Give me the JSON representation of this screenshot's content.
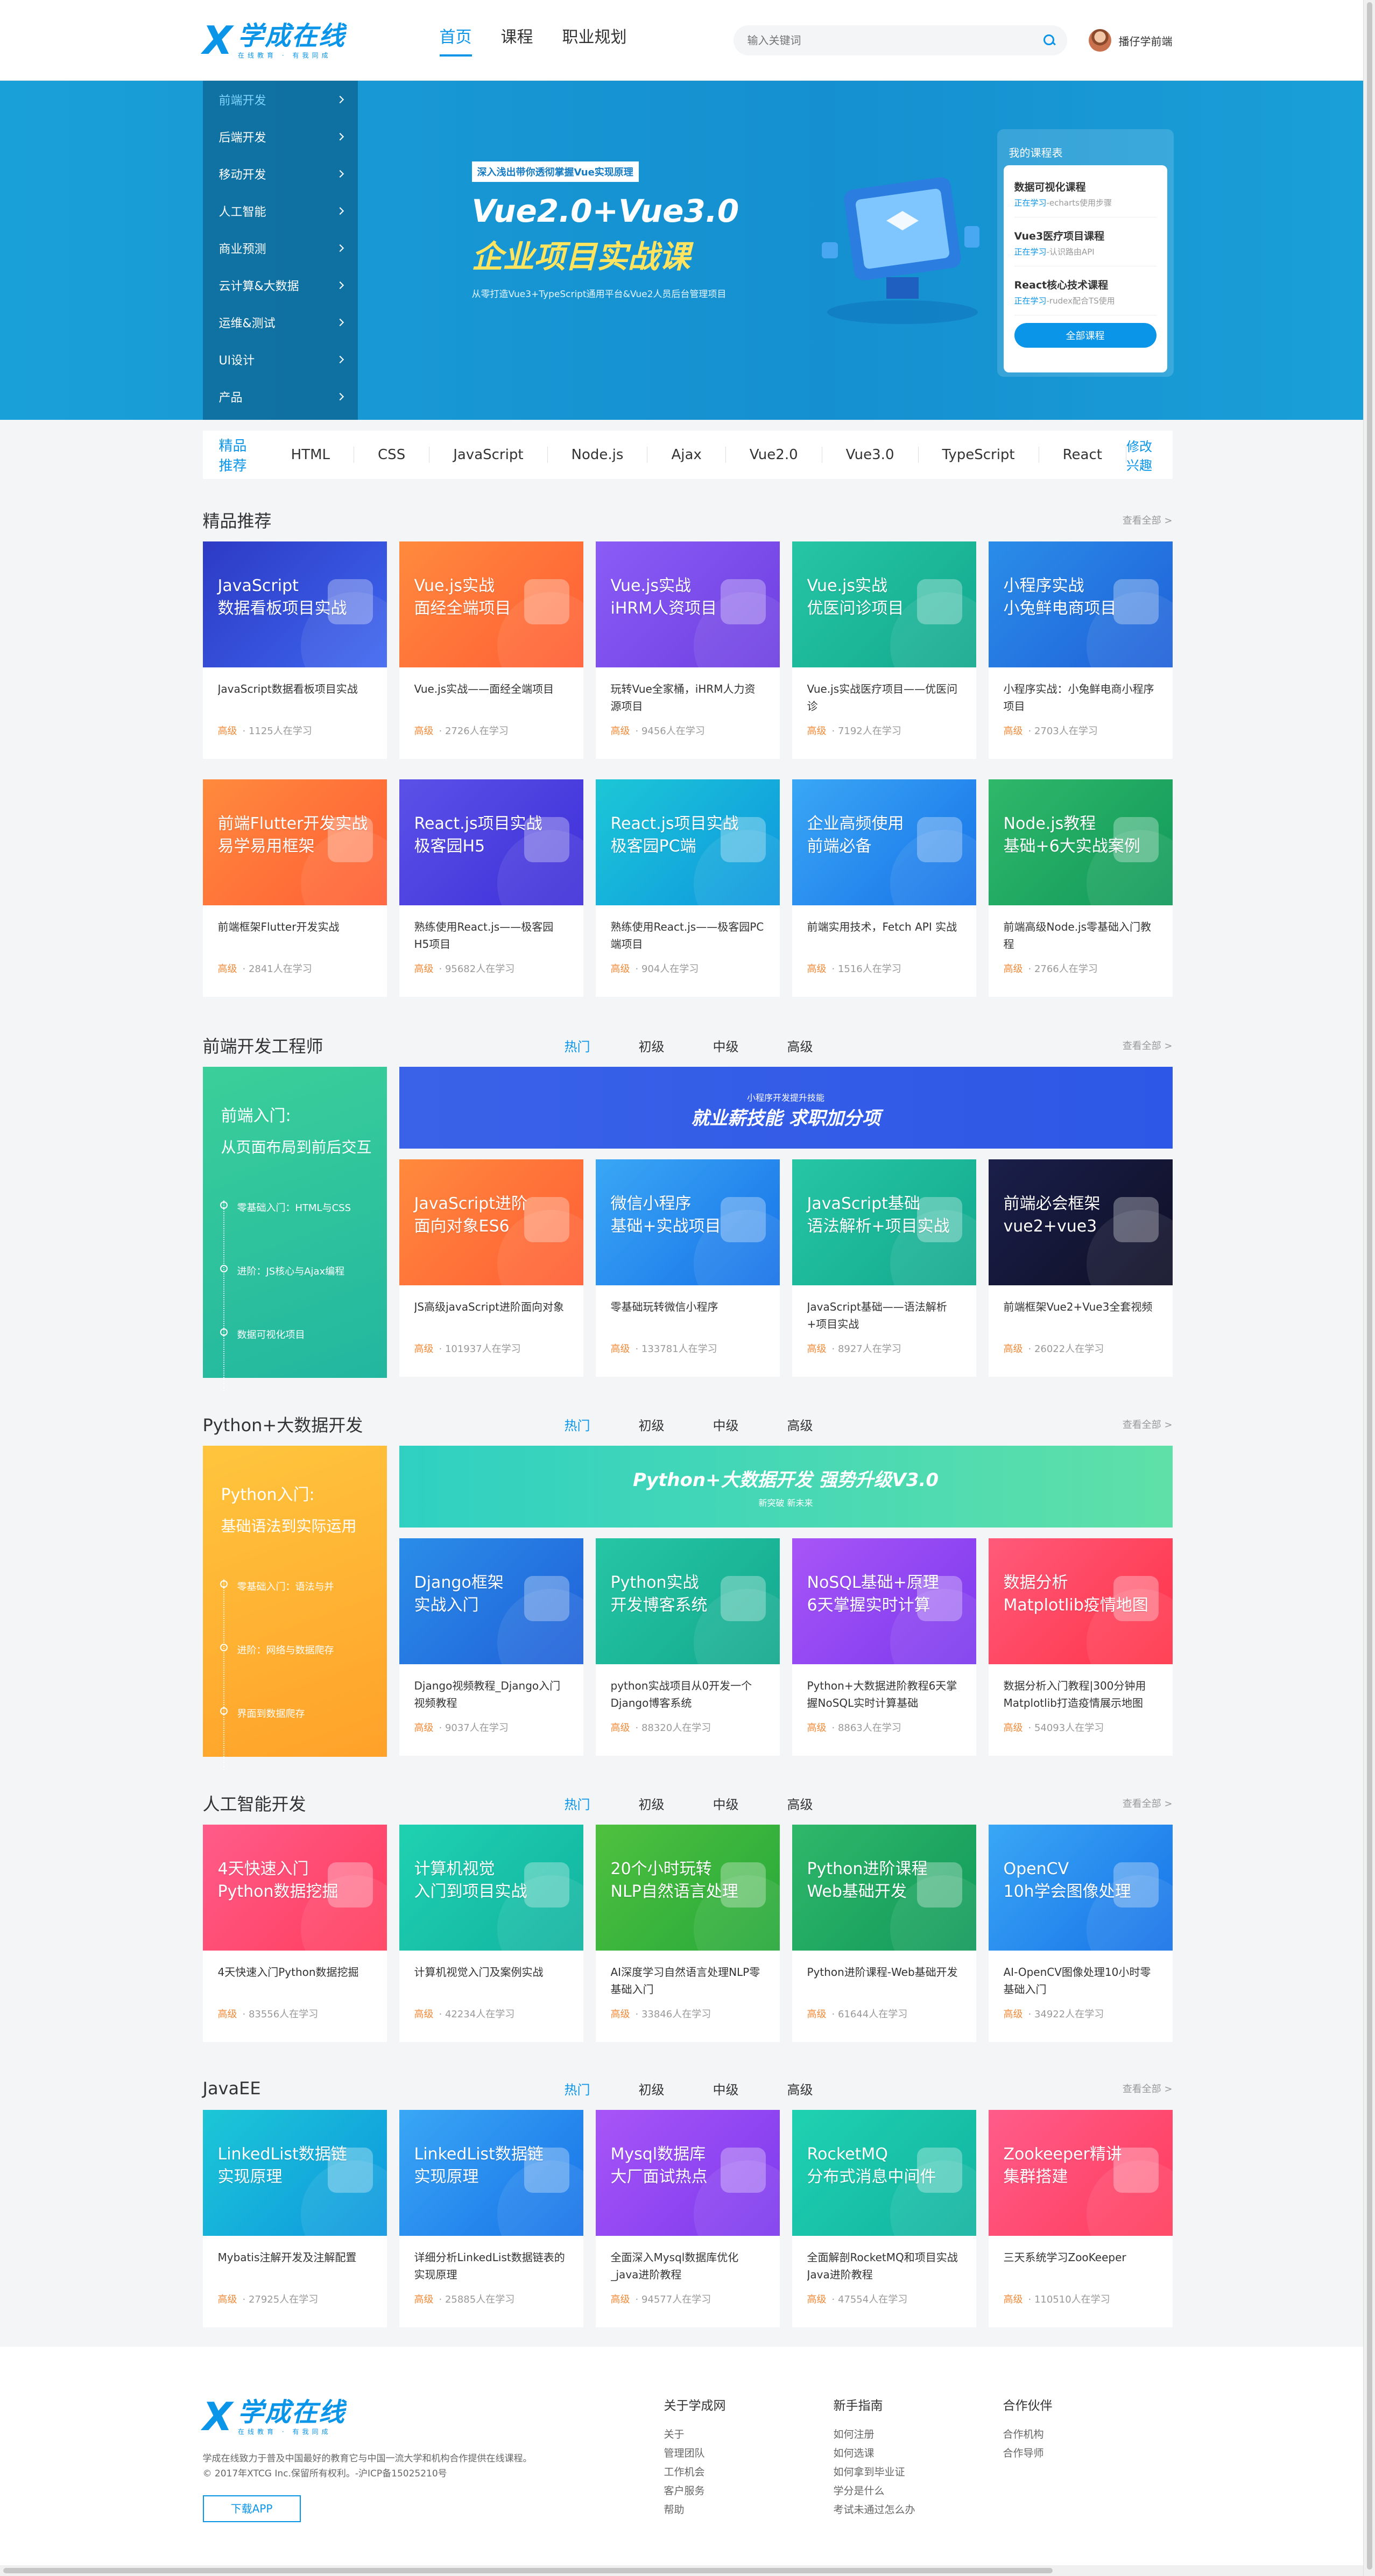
{
  "header": {
    "logo_mark": "X",
    "logo_text": "学成在线",
    "logo_slogan": "在线教育 · 有我同成",
    "nav": [
      "首页",
      "课程",
      "职业规划"
    ],
    "search_placeholder": "输入关键词",
    "user_name": "播仔学前端"
  },
  "banner": {
    "side_menu": [
      "前端开发",
      "后端开发",
      "移动开发",
      "人工智能",
      "商业预测",
      "云计算&大数据",
      "运维&测试",
      "UI设计",
      "产品"
    ],
    "tagline": "深入浅出带你透彻掌握Vue实现原理",
    "title_line1": "Vue2.0+Vue3.0",
    "title_line2": "企业项目实战课",
    "subtitle": "从零打造Vue3+TypeScript通用平台&Vue2人员后台管理项目",
    "my_courses": {
      "heading": "我的课程表",
      "items": [
        {
          "name": "数据可视化课程",
          "status": "正在学习",
          "progress": "-echarts使用步骤"
        },
        {
          "name": "Vue3医疗项目课程",
          "status": "正在学习",
          "progress": "-认识路由API"
        },
        {
          "name": "React核心技术课程",
          "status": "正在学习",
          "progress": "-rudex配合TS使用"
        }
      ],
      "button": "全部课程"
    }
  },
  "recommend_bar": {
    "label": "精品推荐",
    "tags": [
      "HTML",
      "CSS",
      "JavaScript",
      "Node.js",
      "Ajax",
      "Vue2.0",
      "Vue3.0",
      "TypeScript",
      "React"
    ],
    "edit": "修改兴趣"
  },
  "more_label": "查看全部 >",
  "level_tabs": [
    "热门",
    "初级",
    "中级",
    "高级"
  ],
  "sections": {
    "jingpin": {
      "title": "精品推荐",
      "cards": [
        {
          "cover": "JavaScript\n数据看板项目实战",
          "title": "JavaScript数据看板项目实战",
          "level": "高级",
          "count": "· 1125人在学习"
        },
        {
          "cover": "Vue.js实战\n面经全端项目",
          "title": "Vue.js实战——面经全端项目",
          "level": "高级",
          "count": "· 2726人在学习"
        },
        {
          "cover": "Vue.js实战\niHRM人资项目",
          "title": "玩转Vue全家桶，iHRM人力资源项目",
          "level": "高级",
          "count": "· 9456人在学习"
        },
        {
          "cover": "Vue.js实战\n优医问诊项目",
          "title": "Vue.js实战医疗项目——优医问诊",
          "level": "高级",
          "count": "· 7192人在学习"
        },
        {
          "cover": "小程序实战\n小兔鲜电商项目",
          "title": "小程序实战：小兔鲜电商小程序项目",
          "level": "高级",
          "count": "· 2703人在学习"
        },
        {
          "cover": "前端Flutter开发实战\n易学易用框架",
          "title": "前端框架Flutter开发实战",
          "level": "高级",
          "count": "· 2841人在学习"
        },
        {
          "cover": "React.js项目实战\n极客园H5",
          "title": "熟练使用React.js——极客园H5项目",
          "level": "高级",
          "count": "· 95682人在学习"
        },
        {
          "cover": "React.js项目实战\n极客园PC端",
          "title": "熟练使用React.js——极客园PC端项目",
          "level": "高级",
          "count": "· 904人在学习"
        },
        {
          "cover": "企业高频使用\n前端必备",
          "title": "前端实用技术，Fetch API 实战",
          "level": "高级",
          "count": "· 1516人在学习"
        },
        {
          "cover": "Node.js教程\n基础+6大实战案例",
          "title": "前端高级Node.js零基础入门教程",
          "level": "高级",
          "count": "· 2766人在学习"
        }
      ]
    },
    "frontend": {
      "title": "前端开发工程师",
      "left_h1": "前端入门:",
      "left_h2": "从页面布局到前后交互",
      "steps": [
        "零基础入门：HTML与CSS",
        "进阶：JS核心与Ajax编程",
        "数据可视化项目"
      ],
      "banner_text": "就业薪技能 求职加分项",
      "banner_sub": "小程序开发提升技能",
      "cards": [
        {
          "cover": "JavaScript进阶\n面向对象ES6",
          "title": "JS高级javaScript进阶面向对象",
          "level": "高级",
          "count": "· 101937人在学习"
        },
        {
          "cover": "微信小程序\n基础+实战项目",
          "title": "零基础玩转微信小程序",
          "level": "高级",
          "count": "· 133781人在学习"
        },
        {
          "cover": "JavaScript基础\n语法解析+项目实战",
          "title": "JavaScript基础——语法解析+项目实战",
          "level": "高级",
          "count": "· 8927人在学习"
        },
        {
          "cover": "前端必会框架\nvue2+vue3",
          "title": "前端框架Vue2+Vue3全套视频",
          "level": "高级",
          "count": "· 26022人在学习"
        }
      ]
    },
    "python": {
      "title": "Python+大数据开发",
      "left_h1": "Python入门:",
      "left_h2": "基础语法到实际运用",
      "steps": [
        "零基础入门：语法与并",
        "进阶：网络与数据爬存",
        "界面到数据爬存"
      ],
      "banner_text": "Python+大数据开发 强势升级V3.0",
      "banner_sub": "新突破  新未来",
      "cards": [
        {
          "cover": "Django框架\n实战入门",
          "title": "Django视频教程_Django入门视频教程",
          "level": "高级",
          "count": "· 9037人在学习"
        },
        {
          "cover": "Python实战\n开发博客系统",
          "title": "python实战项目从0开发一个Django博客系统",
          "level": "高级",
          "count": "· 88320人在学习"
        },
        {
          "cover": "NoSQL基础+原理\n6天掌握实时计算",
          "title": "Python+大数据进阶教程6天掌握NoSQL实时计算基础",
          "level": "高级",
          "count": "· 8863人在学习"
        },
        {
          "cover": "数据分析\nMatplotlib疫情地图",
          "title": "数据分析入门教程|300分钟用Matplotlib打造疫情展示地图",
          "level": "高级",
          "count": "· 54093人在学习"
        }
      ]
    },
    "ai": {
      "title": "人工智能开发",
      "cards": [
        {
          "cover": "4天快速入门\nPython数据挖掘",
          "title": "4天快速入门Python数据挖掘",
          "level": "高级",
          "count": "· 83556人在学习"
        },
        {
          "cover": "计算机视觉\n入门到项目实战",
          "title": "计算机视觉入门及案例实战",
          "level": "高级",
          "count": "· 42234人在学习"
        },
        {
          "cover": "20个小时玩转\nNLP自然语言处理",
          "title": "AI深度学习自然语言处理NLP零基础入门",
          "level": "高级",
          "count": "· 33846人在学习"
        },
        {
          "cover": "Python进阶课程\nWeb基础开发",
          "title": "Python进阶课程-Web基础开发",
          "level": "高级",
          "count": "· 61644人在学习"
        },
        {
          "cover": "OpenCV\n10h学会图像处理",
          "title": "AI-OpenCV图像处理10小时零基础入门",
          "level": "高级",
          "count": "· 34922人在学习"
        }
      ]
    },
    "javaee": {
      "title": "JavaEE",
      "cards": [
        {
          "cover": "LinkedList数据链\n实现原理",
          "title": "Mybatis注解开发及注解配置",
          "level": "高级",
          "count": "· 27925人在学习"
        },
        {
          "cover": "LinkedList数据链\n实现原理",
          "title": "详细分析LinkedList数据链表的实现原理",
          "level": "高级",
          "count": "· 25885人在学习"
        },
        {
          "cover": "Mysql数据库\n大厂面试热点",
          "title": "全面深入Mysql数据库优化_java进阶教程",
          "level": "高级",
          "count": "· 94577人在学习"
        },
        {
          "cover": "RocketMQ\n分布式消息中间件",
          "title": "全面解剖RocketMQ和项目实战 Java进阶教程",
          "level": "高级",
          "count": "· 47554人在学习"
        },
        {
          "cover": "Zookeeper精讲\n集群搭建",
          "title": "三天系统学习ZooKeeper",
          "level": "高级",
          "count": "· 110510人在学习"
        }
      ]
    }
  },
  "footer": {
    "desc1": "学成在线致力于普及中国最好的教育它与中国一流大学和机构合作提供在线课程。",
    "desc2": "© 2017年XTCG Inc.保留所有权利。-沪ICP备15025210号",
    "app_button": "下载APP",
    "cols": [
      {
        "title": "关于学成网",
        "links": [
          "关于",
          "管理团队",
          "工作机会",
          "客户服务",
          "帮助"
        ]
      },
      {
        "title": "新手指南",
        "links": [
          "如何注册",
          "如何选课",
          "如何拿到毕业证",
          "学分是什么",
          "考试未通过怎么办"
        ]
      },
      {
        "title": "合作伙伴",
        "links": [
          "合作机构",
          "合作导师"
        ]
      }
    ]
  },
  "colors": {
    "accent": "#0b95e8",
    "level": "#f08b3a"
  }
}
